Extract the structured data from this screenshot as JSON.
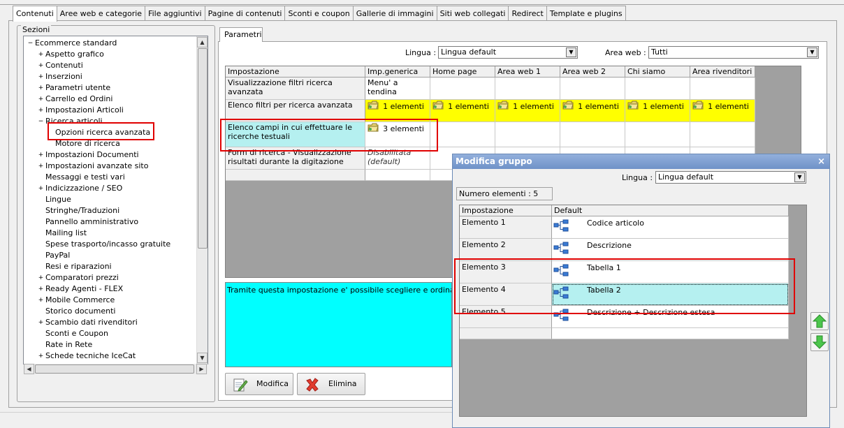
{
  "tabs": [
    "Contenuti",
    "Aree web e categorie",
    "File aggiuntivi",
    "Pagine di contenuti",
    "Sconti e coupon",
    "Gallerie di immagini",
    "Siti web collegati",
    "Redirect",
    "Template e plugins"
  ],
  "sezioni": {
    "label": "Sezioni",
    "tree": [
      {
        "label": "Ecommerce standard",
        "level": 0,
        "toggle": "−"
      },
      {
        "label": "Aspetto grafico",
        "level": 1,
        "toggle": "+"
      },
      {
        "label": "Contenuti",
        "level": 1,
        "toggle": "+"
      },
      {
        "label": "Inserzioni",
        "level": 1,
        "toggle": "+"
      },
      {
        "label": "Parametri utente",
        "level": 1,
        "toggle": "+"
      },
      {
        "label": "Carrello ed Ordini",
        "level": 1,
        "toggle": "+"
      },
      {
        "label": "Impostazioni Articoli",
        "level": 1,
        "toggle": "+"
      },
      {
        "label": "Ricerca articoli",
        "level": 1,
        "toggle": "−"
      },
      {
        "label": "Opzioni ricerca avanzata",
        "level": 2,
        "toggle": "",
        "selected": true
      },
      {
        "label": "Motore di ricerca",
        "level": 2,
        "toggle": ""
      },
      {
        "label": "Impostazioni Documenti",
        "level": 1,
        "toggle": "+"
      },
      {
        "label": "Impostazioni avanzate sito",
        "level": 1,
        "toggle": "+"
      },
      {
        "label": "Messaggi e testi vari",
        "level": 1,
        "toggle": ""
      },
      {
        "label": "Indicizzazione / SEO",
        "level": 1,
        "toggle": "+"
      },
      {
        "label": "Lingue",
        "level": 1,
        "toggle": ""
      },
      {
        "label": "Stringhe/Traduzioni",
        "level": 1,
        "toggle": ""
      },
      {
        "label": "Pannello amministrativo",
        "level": 1,
        "toggle": ""
      },
      {
        "label": "Mailing list",
        "level": 1,
        "toggle": ""
      },
      {
        "label": "Spese trasporto/incasso gratuite",
        "level": 1,
        "toggle": ""
      },
      {
        "label": "PayPal",
        "level": 1,
        "toggle": ""
      },
      {
        "label": "Resi e riparazioni",
        "level": 1,
        "toggle": ""
      },
      {
        "label": "Comparatori prezzi",
        "level": 1,
        "toggle": "+"
      },
      {
        "label": "Ready Agenti - FLEX",
        "level": 1,
        "toggle": "+"
      },
      {
        "label": "Mobile Commerce",
        "level": 1,
        "toggle": "+"
      },
      {
        "label": "Storico documenti",
        "level": 1,
        "toggle": ""
      },
      {
        "label": "Scambio dati rivenditori",
        "level": 1,
        "toggle": "+"
      },
      {
        "label": "Sconti e Coupon",
        "level": 1,
        "toggle": ""
      },
      {
        "label": "Rate in Rete",
        "level": 1,
        "toggle": ""
      },
      {
        "label": "Schede tecniche IceCat",
        "level": 1,
        "toggle": "+"
      }
    ]
  },
  "parametri": {
    "tab": "Parametri",
    "lingua_label": "Lingua :",
    "lingua_value": "Lingua default",
    "area_label": "Area web :",
    "area_value": "Tutti",
    "columns": [
      "Impostazione",
      "Imp.generica",
      "Home page",
      "Area web 1",
      "Area web 2",
      "Chi siamo",
      "Area rivenditori"
    ],
    "rows": [
      {
        "setting": "Visualizzazione filtri ricerca avanzata",
        "generic": "Menu' a tendina",
        "others": []
      },
      {
        "setting": "Elenco filtri per ricerca avanzata",
        "generic": "1 elementi",
        "others": [
          "1 elementi",
          "1 elementi",
          "1 elementi",
          "1 elementi",
          "1 elementi"
        ]
      },
      {
        "setting": "Elenco campi in cui effettuare le ricerche testuali",
        "generic": "3 elementi",
        "others": []
      },
      {
        "setting": "Form di ricerca - Visualizzazione risultati durante la digitazione",
        "generic": "Disabilitata (default)",
        "others": []
      }
    ],
    "description": "Tramite questa impostazione e' possibile scegliere e ordinare i campi",
    "btn_modifica": "Modifica",
    "btn_elimina": "Elimina"
  },
  "dialog": {
    "title": "Modifica gruppo",
    "close": "×",
    "lingua_label": "Lingua :",
    "lingua_value": "Lingua default",
    "numero": "Numero elementi : 5",
    "columns": [
      "Impostazione",
      "Default"
    ],
    "rows": [
      {
        "name": "Elemento 1",
        "value": "Codice articolo"
      },
      {
        "name": "Elemento 2",
        "value": "Descrizione"
      },
      {
        "name": "Elemento 3",
        "value": "Tabella 1"
      },
      {
        "name": "Elemento 4",
        "value": "Tabella 2"
      },
      {
        "name": "Elemento 5",
        "value": "Descrizione + Descrizione estesa"
      }
    ]
  },
  "colors": {
    "highlight": "#ffff00",
    "cyan": "#00ffff",
    "light_cyan": "#b5f0f0",
    "annotation": "#e00000"
  }
}
